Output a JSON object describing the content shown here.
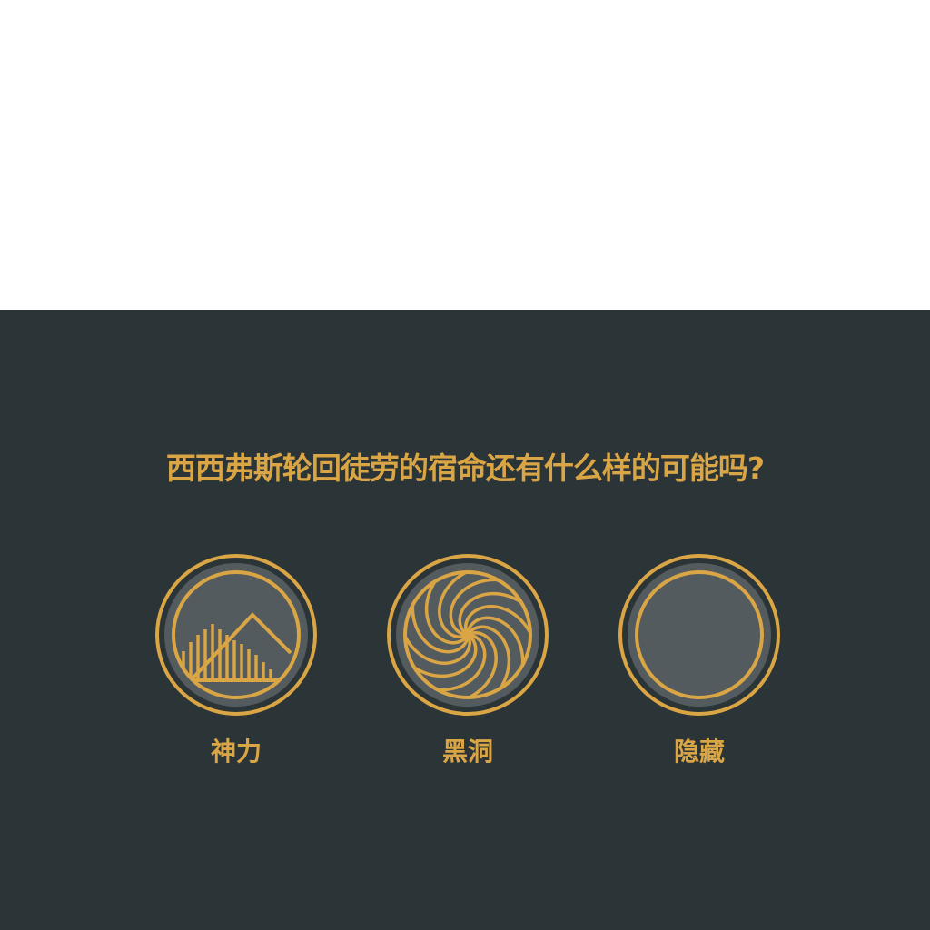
{
  "prompt": {
    "question": "西西弗斯轮回徒劳的宿命还有什么样的可能吗?"
  },
  "options": [
    {
      "label": "神力",
      "icon": "mountain-bars-icon"
    },
    {
      "label": "黑洞",
      "icon": "spiral-icon"
    },
    {
      "label": "隐藏",
      "icon": "empty-circle-icon"
    }
  ],
  "colors": {
    "background": "#2b3437",
    "accent": "#d9a545",
    "disc": "#535b5e",
    "top": "#ffffff"
  }
}
